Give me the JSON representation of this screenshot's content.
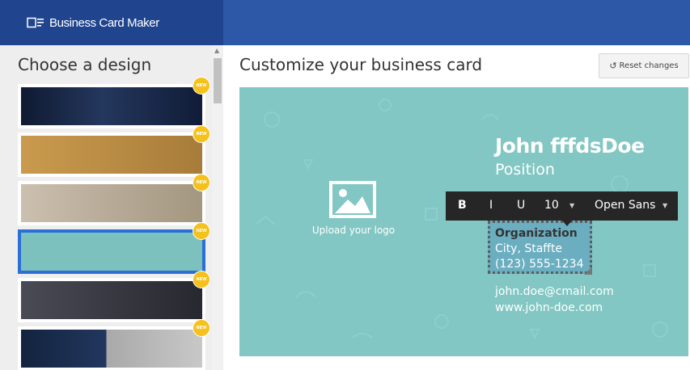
{
  "app": {
    "title": "Business Card Maker",
    "icon": "card-logo-icon"
  },
  "sidebar": {
    "title": "Choose a design",
    "designs": [
      {
        "badge": "NEW",
        "style": "night-sky"
      },
      {
        "badge": "NEW",
        "style": "gold"
      },
      {
        "badge": "NEW",
        "style": "beige"
      },
      {
        "badge": "NEW",
        "style": "teal",
        "selected": true
      },
      {
        "badge": "NEW",
        "style": "charcoal"
      },
      {
        "badge": "NEW",
        "style": "sky-silver"
      }
    ]
  },
  "main": {
    "title": "Customize your business card",
    "reset_label": "Reset changes",
    "reset_icon": "undo-icon"
  },
  "card": {
    "background": "#82c7c3",
    "logo_label": "Upload your logo",
    "logo_icon": "image-icon",
    "name": "John fffdsDoe",
    "position": "Position",
    "organization": "Organization",
    "city": "City, Staffte",
    "phone": "(123) 555-1234",
    "email": "john.doe@cmail.com",
    "website": "www.john-doe.com"
  },
  "toolbar": {
    "bold": "B",
    "italic": "I",
    "underline": "U",
    "font_size": "10",
    "font_family": "Open Sans"
  },
  "colors": {
    "header": "#2d58a7",
    "brand": "#20458e",
    "badge": "#f5c11a",
    "selected_border": "#2b6fd6"
  }
}
